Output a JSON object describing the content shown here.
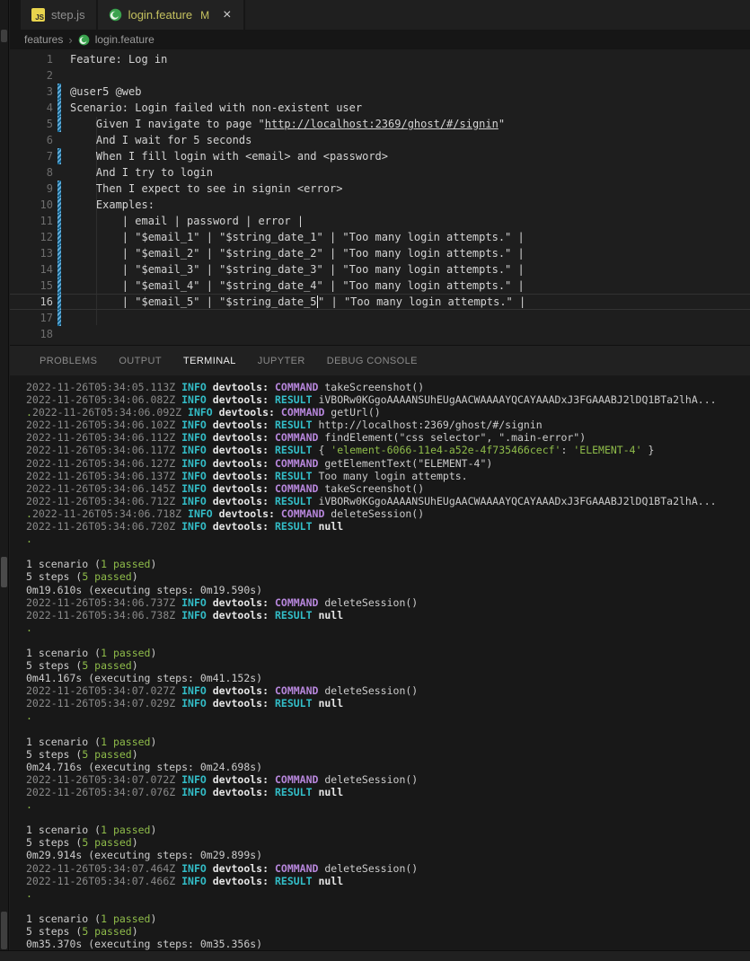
{
  "tabs": {
    "tab1": {
      "label": "step.js",
      "icon": "js-icon"
    },
    "tab2": {
      "label": "login.feature",
      "modified_badge": "M",
      "close_glyph": "×",
      "icon": "cucumber-icon"
    }
  },
  "breadcrumb": {
    "folder": "features",
    "separator": "›",
    "file": "login.feature"
  },
  "colors": {
    "git_modified": "#c4c15f",
    "gutter_modified_blue": "#6cb2dd",
    "terminal_info_cyan": "#33bdc7",
    "terminal_command_purple": "#b887dd",
    "terminal_green": "#8fbc4a",
    "cucumber_green": "#3aa24e"
  },
  "editor": {
    "lines": [
      {
        "num": "1",
        "mod": false,
        "cur": false,
        "parts": [
          [
            "code",
            "Feature: Log in"
          ]
        ]
      },
      {
        "num": "2",
        "mod": false,
        "cur": false,
        "parts": [
          [
            "code",
            ""
          ]
        ]
      },
      {
        "num": "3",
        "mod": true,
        "cur": false,
        "parts": [
          [
            "code",
            "@user5 @web"
          ]
        ]
      },
      {
        "num": "4",
        "mod": true,
        "cur": false,
        "parts": [
          [
            "code",
            "Scenario: Login failed with non-existent user"
          ]
        ]
      },
      {
        "num": "5",
        "mod": true,
        "cur": false,
        "parts": [
          [
            "code",
            "    Given I navigate to page \""
          ],
          [
            "url",
            "http://localhost:2369/ghost/#/signin"
          ],
          [
            "code",
            "\""
          ]
        ]
      },
      {
        "num": "6",
        "mod": false,
        "cur": false,
        "parts": [
          [
            "code",
            "    And I wait for 5 seconds"
          ]
        ]
      },
      {
        "num": "7",
        "mod": true,
        "cur": false,
        "parts": [
          [
            "code",
            "    When I fill login with <email> and <password>"
          ]
        ]
      },
      {
        "num": "8",
        "mod": false,
        "cur": false,
        "parts": [
          [
            "code",
            "    And I try to login"
          ]
        ]
      },
      {
        "num": "9",
        "mod": true,
        "cur": false,
        "parts": [
          [
            "code",
            "    Then I expect to see in signin <error>"
          ]
        ]
      },
      {
        "num": "10",
        "mod": true,
        "cur": false,
        "parts": [
          [
            "code",
            "    Examples:"
          ]
        ]
      },
      {
        "num": "11",
        "mod": true,
        "cur": false,
        "parts": [
          [
            "code",
            "        | email | password | error |"
          ]
        ]
      },
      {
        "num": "12",
        "mod": true,
        "cur": false,
        "parts": [
          [
            "code",
            "        | \"$email_1\" | \"$string_date_1\" | \"Too many login attempts.\" |"
          ]
        ]
      },
      {
        "num": "13",
        "mod": true,
        "cur": false,
        "parts": [
          [
            "code",
            "        | \"$email_2\" | \"$string_date_2\" | \"Too many login attempts.\" |"
          ]
        ]
      },
      {
        "num": "14",
        "mod": true,
        "cur": false,
        "parts": [
          [
            "code",
            "        | \"$email_3\" | \"$string_date_3\" | \"Too many login attempts.\" |"
          ]
        ]
      },
      {
        "num": "15",
        "mod": true,
        "cur": false,
        "parts": [
          [
            "code",
            "        | \"$email_4\" | \"$string_date_4\" | \"Too many login attempts.\" |"
          ]
        ]
      },
      {
        "num": "16",
        "mod": true,
        "cur": true,
        "parts": [
          [
            "code",
            "        | \"$email_5\" | \"$string_date_5"
          ],
          [
            "cursor",
            ""
          ],
          [
            "code",
            "\" | \"Too many login attempts.\" |"
          ]
        ]
      },
      {
        "num": "17",
        "mod": true,
        "cur": false,
        "parts": [
          [
            "code",
            ""
          ]
        ]
      },
      {
        "num": "18",
        "mod": false,
        "cur": false,
        "parts": [
          [
            "code",
            ""
          ]
        ]
      }
    ]
  },
  "panel": {
    "tabs": [
      {
        "label": "PROBLEMS",
        "active": false
      },
      {
        "label": "OUTPUT",
        "active": false
      },
      {
        "label": "TERMINAL",
        "active": true
      },
      {
        "label": "JUPYTER",
        "active": false
      },
      {
        "label": "DEBUG CONSOLE",
        "active": false
      }
    ]
  },
  "terminal": {
    "rows": [
      [
        [
          "ts",
          "2022-11-26T05:34:05.113Z "
        ],
        [
          "info",
          "INFO "
        ],
        [
          "dev",
          "devtools: "
        ],
        [
          "cmd",
          "COMMAND "
        ],
        [
          "p",
          "takeScreenshot()"
        ]
      ],
      [
        [
          "ts",
          "2022-11-26T05:34:06.082Z "
        ],
        [
          "info",
          "INFO "
        ],
        [
          "dev",
          "devtools: "
        ],
        [
          "res",
          "RESULT "
        ],
        [
          "p",
          "iVBORw0KGgoAAAANSUhEUgAACWAAAAYQCAYAAADxJ3FGAAABJ2lDQ1BTa2lhA..."
        ]
      ],
      [
        [
          "g",
          "."
        ],
        [
          "ts",
          "2022-11-26T05:34:06.092Z "
        ],
        [
          "info",
          "INFO "
        ],
        [
          "dev",
          "devtools: "
        ],
        [
          "cmd",
          "COMMAND "
        ],
        [
          "p",
          "getUrl()"
        ]
      ],
      [
        [
          "ts",
          "2022-11-26T05:34:06.102Z "
        ],
        [
          "info",
          "INFO "
        ],
        [
          "dev",
          "devtools: "
        ],
        [
          "res",
          "RESULT "
        ],
        [
          "p",
          "http://localhost:2369/ghost/#/signin"
        ]
      ],
      [
        [
          "ts",
          "2022-11-26T05:34:06.112Z "
        ],
        [
          "info",
          "INFO "
        ],
        [
          "dev",
          "devtools: "
        ],
        [
          "cmd",
          "COMMAND "
        ],
        [
          "p",
          "findElement(\"css selector\", \".main-error\")"
        ]
      ],
      [
        [
          "ts",
          "2022-11-26T05:34:06.117Z "
        ],
        [
          "info",
          "INFO "
        ],
        [
          "dev",
          "devtools: "
        ],
        [
          "res",
          "RESULT "
        ],
        [
          "p",
          "{ "
        ],
        [
          "g",
          "'element-6066-11e4-a52e-4f735466cecf'"
        ],
        [
          "p",
          ": "
        ],
        [
          "g",
          "'ELEMENT-4'"
        ],
        [
          "p",
          " }"
        ]
      ],
      [
        [
          "ts",
          "2022-11-26T05:34:06.127Z "
        ],
        [
          "info",
          "INFO "
        ],
        [
          "dev",
          "devtools: "
        ],
        [
          "cmd",
          "COMMAND "
        ],
        [
          "p",
          "getElementText(\"ELEMENT-4\")"
        ]
      ],
      [
        [
          "ts",
          "2022-11-26T05:34:06.137Z "
        ],
        [
          "info",
          "INFO "
        ],
        [
          "dev",
          "devtools: "
        ],
        [
          "res",
          "RESULT "
        ],
        [
          "p",
          "Too many login attempts."
        ]
      ],
      [
        [
          "ts",
          "2022-11-26T05:34:06.145Z "
        ],
        [
          "info",
          "INFO "
        ],
        [
          "dev",
          "devtools: "
        ],
        [
          "cmd",
          "COMMAND "
        ],
        [
          "p",
          "takeScreenshot()"
        ]
      ],
      [
        [
          "ts",
          "2022-11-26T05:34:06.712Z "
        ],
        [
          "info",
          "INFO "
        ],
        [
          "dev",
          "devtools: "
        ],
        [
          "res",
          "RESULT "
        ],
        [
          "p",
          "iVBORw0KGgoAAAANSUhEUgAACWAAAAYQCAYAAADxJ3FGAAABJ2lDQ1BTa2lhA..."
        ]
      ],
      [
        [
          "g",
          "."
        ],
        [
          "ts",
          "2022-11-26T05:34:06.718Z "
        ],
        [
          "info",
          "INFO "
        ],
        [
          "dev",
          "devtools: "
        ],
        [
          "cmd",
          "COMMAND "
        ],
        [
          "p",
          "deleteSession()"
        ]
      ],
      [
        [
          "ts",
          "2022-11-26T05:34:06.720Z "
        ],
        [
          "info",
          "INFO "
        ],
        [
          "dev",
          "devtools: "
        ],
        [
          "res",
          "RESULT "
        ],
        [
          "b",
          "null"
        ]
      ],
      [
        [
          "g",
          "."
        ]
      ],
      [],
      [
        [
          "p",
          "1 scenario ("
        ],
        [
          "g",
          "1 passed"
        ],
        [
          "p",
          ")"
        ]
      ],
      [
        [
          "p",
          "5 steps ("
        ],
        [
          "g",
          "5 passed"
        ],
        [
          "p",
          ")"
        ]
      ],
      [
        [
          "p",
          "0m19.610s (executing steps: 0m19.590s)"
        ]
      ],
      [
        [
          "ts",
          "2022-11-26T05:34:06.737Z "
        ],
        [
          "info",
          "INFO "
        ],
        [
          "dev",
          "devtools: "
        ],
        [
          "cmd",
          "COMMAND "
        ],
        [
          "p",
          "deleteSession()"
        ]
      ],
      [
        [
          "ts",
          "2022-11-26T05:34:06.738Z "
        ],
        [
          "info",
          "INFO "
        ],
        [
          "dev",
          "devtools: "
        ],
        [
          "res",
          "RESULT "
        ],
        [
          "b",
          "null"
        ]
      ],
      [
        [
          "g",
          "."
        ]
      ],
      [],
      [
        [
          "p",
          "1 scenario ("
        ],
        [
          "g",
          "1 passed"
        ],
        [
          "p",
          ")"
        ]
      ],
      [
        [
          "p",
          "5 steps ("
        ],
        [
          "g",
          "5 passed"
        ],
        [
          "p",
          ")"
        ]
      ],
      [
        [
          "p",
          "0m41.167s (executing steps: 0m41.152s)"
        ]
      ],
      [
        [
          "ts",
          "2022-11-26T05:34:07.027Z "
        ],
        [
          "info",
          "INFO "
        ],
        [
          "dev",
          "devtools: "
        ],
        [
          "cmd",
          "COMMAND "
        ],
        [
          "p",
          "deleteSession()"
        ]
      ],
      [
        [
          "ts",
          "2022-11-26T05:34:07.029Z "
        ],
        [
          "info",
          "INFO "
        ],
        [
          "dev",
          "devtools: "
        ],
        [
          "res",
          "RESULT "
        ],
        [
          "b",
          "null"
        ]
      ],
      [
        [
          "g",
          "."
        ]
      ],
      [],
      [
        [
          "p",
          "1 scenario ("
        ],
        [
          "g",
          "1 passed"
        ],
        [
          "p",
          ")"
        ]
      ],
      [
        [
          "p",
          "5 steps ("
        ],
        [
          "g",
          "5 passed"
        ],
        [
          "p",
          ")"
        ]
      ],
      [
        [
          "p",
          "0m24.716s (executing steps: 0m24.698s)"
        ]
      ],
      [
        [
          "ts",
          "2022-11-26T05:34:07.072Z "
        ],
        [
          "info",
          "INFO "
        ],
        [
          "dev",
          "devtools: "
        ],
        [
          "cmd",
          "COMMAND "
        ],
        [
          "p",
          "deleteSession()"
        ]
      ],
      [
        [
          "ts",
          "2022-11-26T05:34:07.076Z "
        ],
        [
          "info",
          "INFO "
        ],
        [
          "dev",
          "devtools: "
        ],
        [
          "res",
          "RESULT "
        ],
        [
          "b",
          "null"
        ]
      ],
      [
        [
          "g",
          "."
        ]
      ],
      [],
      [
        [
          "p",
          "1 scenario ("
        ],
        [
          "g",
          "1 passed"
        ],
        [
          "p",
          ")"
        ]
      ],
      [
        [
          "p",
          "5 steps ("
        ],
        [
          "g",
          "5 passed"
        ],
        [
          "p",
          ")"
        ]
      ],
      [
        [
          "p",
          "0m29.914s (executing steps: 0m29.899s)"
        ]
      ],
      [
        [
          "ts",
          "2022-11-26T05:34:07.464Z "
        ],
        [
          "info",
          "INFO "
        ],
        [
          "dev",
          "devtools: "
        ],
        [
          "cmd",
          "COMMAND "
        ],
        [
          "p",
          "deleteSession()"
        ]
      ],
      [
        [
          "ts",
          "2022-11-26T05:34:07.466Z "
        ],
        [
          "info",
          "INFO "
        ],
        [
          "dev",
          "devtools: "
        ],
        [
          "res",
          "RESULT "
        ],
        [
          "b",
          "null"
        ]
      ],
      [
        [
          "g",
          "."
        ]
      ],
      [],
      [
        [
          "p",
          "1 scenario ("
        ],
        [
          "g",
          "1 passed"
        ],
        [
          "p",
          ")"
        ]
      ],
      [
        [
          "p",
          "5 steps ("
        ],
        [
          "g",
          "5 passed"
        ],
        [
          "p",
          ")"
        ]
      ],
      [
        [
          "p",
          "0m35.370s (executing steps: 0m35.356s)"
        ]
      ]
    ]
  }
}
